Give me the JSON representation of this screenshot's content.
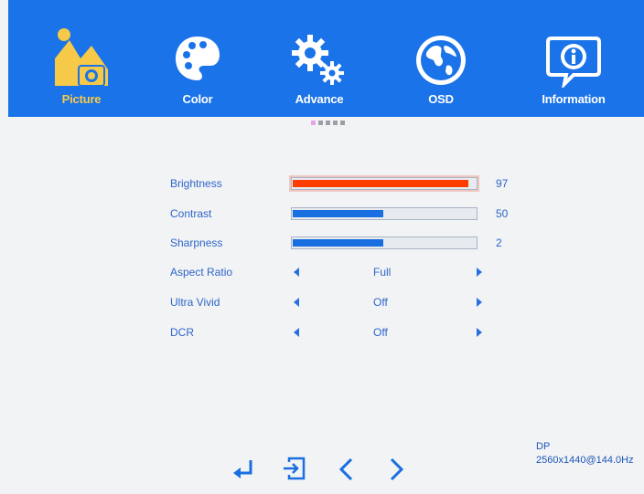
{
  "tabs": [
    {
      "label": "Picture",
      "icon": "picture-icon",
      "active": true
    },
    {
      "label": "Color",
      "icon": "palette-icon",
      "active": false
    },
    {
      "label": "Advance",
      "icon": "gears-icon",
      "active": false
    },
    {
      "label": "OSD",
      "icon": "globe-icon",
      "active": false
    },
    {
      "label": "Information",
      "icon": "info-icon",
      "active": false
    }
  ],
  "settings": {
    "brightness": {
      "label": "Brightness",
      "value": "97",
      "level": 0.97
    },
    "contrast": {
      "label": "Contrast",
      "value": "50",
      "level": 0.5
    },
    "sharpness": {
      "label": "Sharpness",
      "value": "2",
      "level": 0.5
    },
    "aspect_ratio": {
      "label": "Aspect Ratio",
      "value": "Full"
    },
    "ultra_vivid": {
      "label": "Ultra Vivid",
      "value": "Off"
    },
    "dcr": {
      "label": "DCR",
      "value": "Off"
    }
  },
  "footer": {
    "input": "DP",
    "resolution": "2560x1440@144.0Hz"
  },
  "colors": {
    "topbar": "#1a73e8",
    "active_tab": "#f7c948",
    "text": "#2f66c9",
    "bar_fill": "#1a6fe0",
    "selected_bar_fill": "#ff3d00"
  },
  "nav": [
    "enter-icon",
    "exit-icon",
    "chevron-left-icon",
    "chevron-right-icon"
  ]
}
